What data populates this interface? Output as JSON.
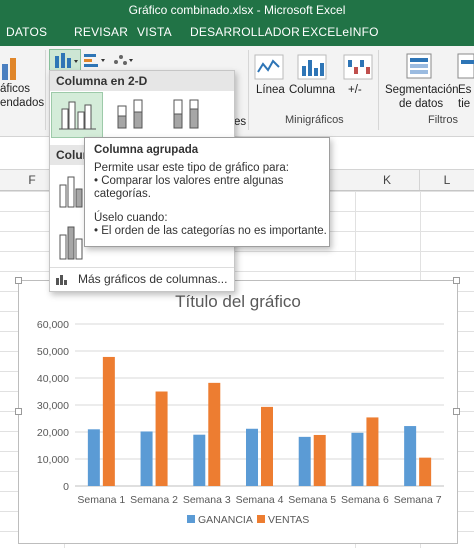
{
  "window": {
    "title": "Gráfico combinado.xlsx - Microsoft Excel"
  },
  "tabs": [
    "DATOS",
    "REVISAR",
    "VISTA",
    "DESARROLLADOR",
    "EXCELeINFO"
  ],
  "ribbon": {
    "recommended_charts_label_1": "áficos",
    "recommended_charts_label_2": "endados",
    "group_charts_partial": "es",
    "sparklines": {
      "line": "Línea",
      "column": "Columna",
      "winloss": "+/-",
      "group": "Minigráficos"
    },
    "filters": {
      "slicer_1": "Segmentación",
      "slicer_2": "de datos",
      "timeline_1": "Es",
      "timeline_2": "tie",
      "group": "Filtros"
    }
  },
  "columns": {
    "f": "F",
    "k": "K",
    "l": "L"
  },
  "dropdown": {
    "section_2d": "Columna en 2-D",
    "section_3d_partial": "Colum",
    "more": "Más gráficos de columnas..."
  },
  "tooltip": {
    "title": "Columna agrupada",
    "line1": "Permite usar este tipo de gráfico para:",
    "line2": "• Comparar los valores entre algunas",
    "line3": "categorías.",
    "line4": "Úselo cuando:",
    "line5": "• El orden de las categorías no es importante."
  },
  "colors": {
    "excel_green": "#217346",
    "ganancia": "#5b9bd5",
    "ventas": "#ed7d31"
  },
  "chart_data": {
    "type": "bar",
    "title": "Título del gráfico",
    "categories": [
      "Semana 1",
      "Semana 2",
      "Semana 3",
      "Semana 4",
      "Semana 5",
      "Semana 6",
      "Semana 7"
    ],
    "series": [
      {
        "name": "GANANCIA",
        "values": [
          21000,
          20200,
          19000,
          21200,
          18200,
          19700,
          22200
        ]
      },
      {
        "name": "VENTAS",
        "values": [
          47800,
          35000,
          38200,
          29300,
          18900,
          25400,
          10500
        ]
      }
    ],
    "ylim": [
      0,
      60000
    ],
    "yticks": [
      "0",
      "10,000",
      "20,000",
      "30,000",
      "40,000",
      "50,000",
      "60,000"
    ],
    "grid": true,
    "legend": "bottom"
  }
}
